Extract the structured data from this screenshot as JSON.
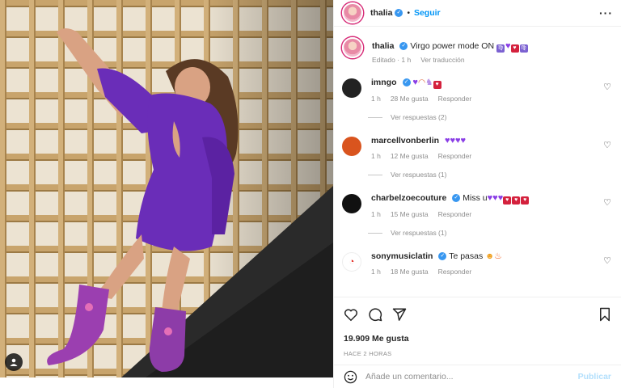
{
  "colors": {
    "accent": "#0095f6",
    "verified": "#3897f0",
    "dress": "#6a2db8",
    "wood": "#c8a46c",
    "muted": "#8e8e8e"
  },
  "post": {
    "author": "thalia",
    "follow_label": "Seguir",
    "caption_user": "thalia",
    "caption_text": "Virgo power mode ON",
    "caption_meta": {
      "edited": "Editado · 1 h",
      "translate": "Ver traducción"
    },
    "likes": "19.909 Me gusta",
    "date": "HACE 2 HORAS",
    "comment_placeholder": "Añade un comentario...",
    "post_label": "Publicar"
  },
  "comments": [
    {
      "user": "imngo",
      "text": "",
      "emoji": [
        "purple-heart-icon",
        "rainbow-icon",
        "unicorn-icon",
        "red-heart-icon"
      ],
      "time": "1 h",
      "likes": "28 Me gusta",
      "reply": "Responder",
      "replies": "Ver respuestas (2)"
    },
    {
      "user": "marcellvonberlin",
      "text": "",
      "emoji": [
        "purple-heart-icon",
        "purple-heart-icon",
        "purple-heart-icon",
        "purple-heart-icon"
      ],
      "time": "1 h",
      "likes": "12 Me gusta",
      "reply": "Responder",
      "replies": "Ver respuestas (1)"
    },
    {
      "user": "charbelzoecouture",
      "text": "Miss u",
      "emoji": [
        "purple-heart-icon",
        "purple-heart-icon",
        "purple-heart-icon",
        "red-heart-icon",
        "red-heart-icon",
        "red-heart-icon"
      ],
      "time": "1 h",
      "likes": "15 Me gusta",
      "reply": "Responder",
      "replies": "Ver respuestas (1)"
    },
    {
      "user": "sonymusiclatin",
      "text": "Te pasas",
      "emoji": [
        "star-struck-icon",
        "fire-icon"
      ],
      "time": "1 h",
      "likes": "18 Me gusta",
      "reply": "Responder"
    }
  ]
}
